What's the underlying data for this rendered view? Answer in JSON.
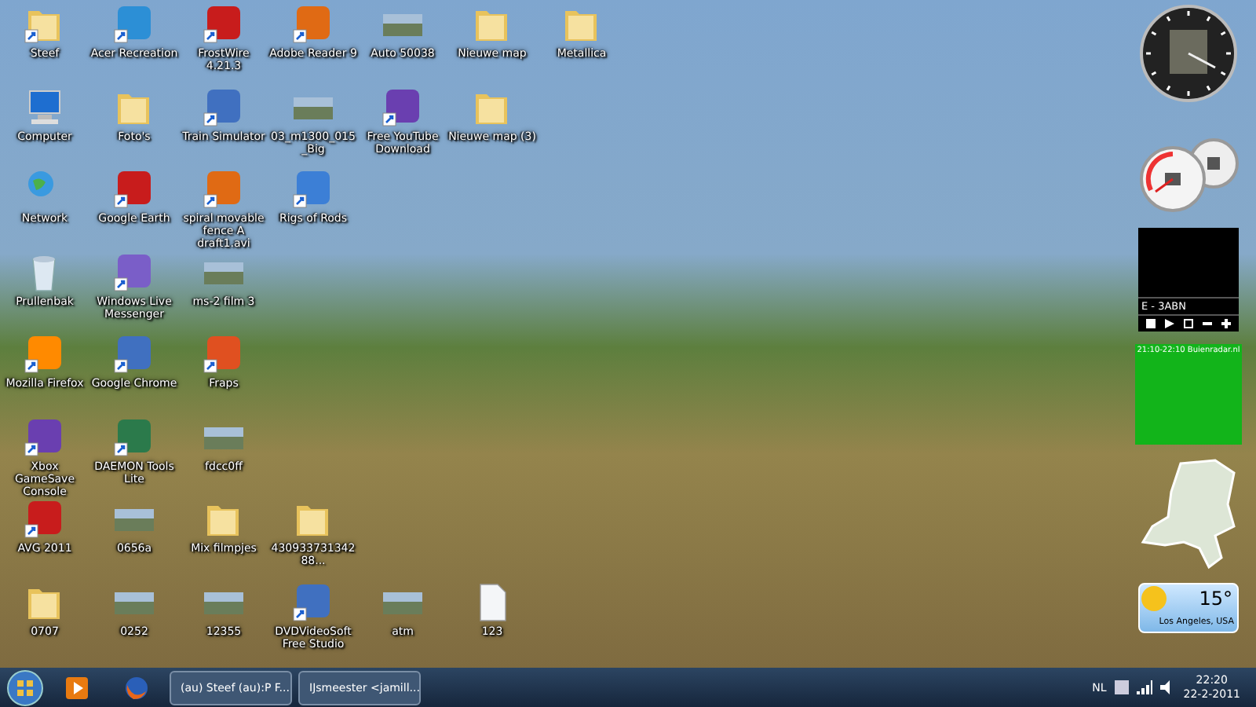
{
  "desktop": {
    "rows": [
      [
        {
          "label": "Steef",
          "kind": "folder",
          "shortcut": true
        },
        {
          "label": "Acer Recreation",
          "kind": "app",
          "shortcut": true
        },
        {
          "label": "FrostWire 4.21.3",
          "kind": "app",
          "shortcut": true
        },
        {
          "label": "Adobe Reader 9",
          "kind": "app",
          "shortcut": true
        },
        {
          "label": "Auto 50038",
          "kind": "photo",
          "shortcut": false
        },
        {
          "label": "Nieuwe map",
          "kind": "folder",
          "shortcut": false
        },
        {
          "label": "Metallica",
          "kind": "folder",
          "shortcut": false
        }
      ],
      [
        {
          "label": "Computer",
          "kind": "computer",
          "shortcut": false
        },
        {
          "label": "Foto's",
          "kind": "folder",
          "shortcut": false
        },
        {
          "label": "Train Simulator",
          "kind": "app",
          "shortcut": true
        },
        {
          "label": "03_m1300_015_Big",
          "kind": "photo",
          "shortcut": false
        },
        {
          "label": "Free YouTube Download",
          "kind": "app",
          "shortcut": true
        },
        {
          "label": "Nieuwe map (3)",
          "kind": "folder",
          "shortcut": false
        }
      ],
      [
        {
          "label": "Network",
          "kind": "network",
          "shortcut": false
        },
        {
          "label": "Google Earth",
          "kind": "app",
          "shortcut": true
        },
        {
          "label": "spiral movable fence A draft1.avi",
          "kind": "app",
          "shortcut": true
        },
        {
          "label": "Rigs of Rods",
          "kind": "app",
          "shortcut": true
        }
      ],
      [
        {
          "label": "Prullenbak",
          "kind": "bin",
          "shortcut": false
        },
        {
          "label": "Windows Live Messenger",
          "kind": "app",
          "shortcut": true
        },
        {
          "label": "ms-2 film 3",
          "kind": "photo",
          "shortcut": false
        }
      ],
      [
        {
          "label": "Mozilla Firefox",
          "kind": "app",
          "shortcut": true
        },
        {
          "label": "Google Chrome",
          "kind": "app",
          "shortcut": true
        },
        {
          "label": "Fraps",
          "kind": "app",
          "shortcut": true
        }
      ],
      [
        {
          "label": "Xbox GameSave Console",
          "kind": "app",
          "shortcut": true
        },
        {
          "label": "DAEMON Tools Lite",
          "kind": "app",
          "shortcut": true
        },
        {
          "label": "fdcc0ff",
          "kind": "photo",
          "shortcut": false
        }
      ],
      [
        {
          "label": "AVG 2011",
          "kind": "app",
          "shortcut": true
        },
        {
          "label": "0656a",
          "kind": "photo",
          "shortcut": false
        },
        {
          "label": "Mix filmpjes",
          "kind": "folder",
          "shortcut": false
        },
        {
          "label": "43093373134288...",
          "kind": "folder",
          "shortcut": false
        }
      ],
      [
        {
          "label": "0707",
          "kind": "folder",
          "shortcut": false
        },
        {
          "label": "0252",
          "kind": "photo",
          "shortcut": false
        },
        {
          "label": "12355",
          "kind": "photo",
          "shortcut": false
        },
        {
          "label": "DVDVideoSoft Free Studio",
          "kind": "app",
          "shortcut": true
        },
        {
          "label": "atm",
          "kind": "photo",
          "shortcut": false
        },
        {
          "label": "123",
          "kind": "file",
          "shortcut": false
        }
      ]
    ]
  },
  "gadgets": {
    "media_player": {
      "channel": "E - 3ABN"
    },
    "rain_radar": {
      "caption": "21:10-22:10 Buienradar.nl"
    },
    "weather": {
      "temperature": "15°",
      "location": "Los Angeles, USA"
    }
  },
  "taskbar": {
    "tasks": [
      {
        "label": "(au) Steef (au):P F...",
        "selected": false
      },
      {
        "label": "IJsmeester <jamill...",
        "selected": false
      }
    ],
    "language": "NL",
    "time": "22:20",
    "date": "22-2-2011"
  }
}
